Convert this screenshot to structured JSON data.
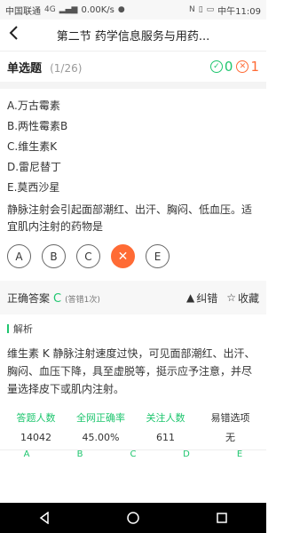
{
  "status_bar": {
    "carrier": "中国联通",
    "network": "4G",
    "speed": "0.00K/s",
    "time": "中午11:09"
  },
  "nav": {
    "back_icon": "back-chevron-icon",
    "title": "第二节 药学信息服务与用药..."
  },
  "question": {
    "type_label": "单选题",
    "progress": "(1/26)",
    "right_count": "0",
    "wrong_count": "1",
    "options": [
      "A.万古霉素",
      "B.两性霉素B",
      "C.维生素K",
      "D.雷尼替丁",
      "E.莫西沙星"
    ],
    "stem": "静脉注射会引起面部潮红、出汗、胸闷、低血压。适宜肌内注射的药物是"
  },
  "answers": [
    "A",
    "B",
    "C",
    "✕",
    "E"
  ],
  "result": {
    "label": "正确答案",
    "letter": "C",
    "wrong_times": "(答错1次)",
    "report_label": "纠错",
    "favorite_label": "收藏"
  },
  "explanation": {
    "label": "解析",
    "text": "维生素 K 静脉注射速度过快，可见面部潮红、出汗、胸闷、血压下降，具至虚脱等，挺示应予注意，并尽量选择皮下或肌内注射。"
  },
  "stats": {
    "headers": [
      "答题人数",
      "全网正确率",
      "关注人数",
      "易错选项"
    ],
    "values": [
      "14042",
      "45.00%",
      "611",
      "无"
    ]
  },
  "letters": [
    "A",
    "B",
    "C",
    "D",
    "E"
  ],
  "colors": {
    "accent_green": "#1fc66f",
    "wrong_orange": "#ff6b35"
  }
}
